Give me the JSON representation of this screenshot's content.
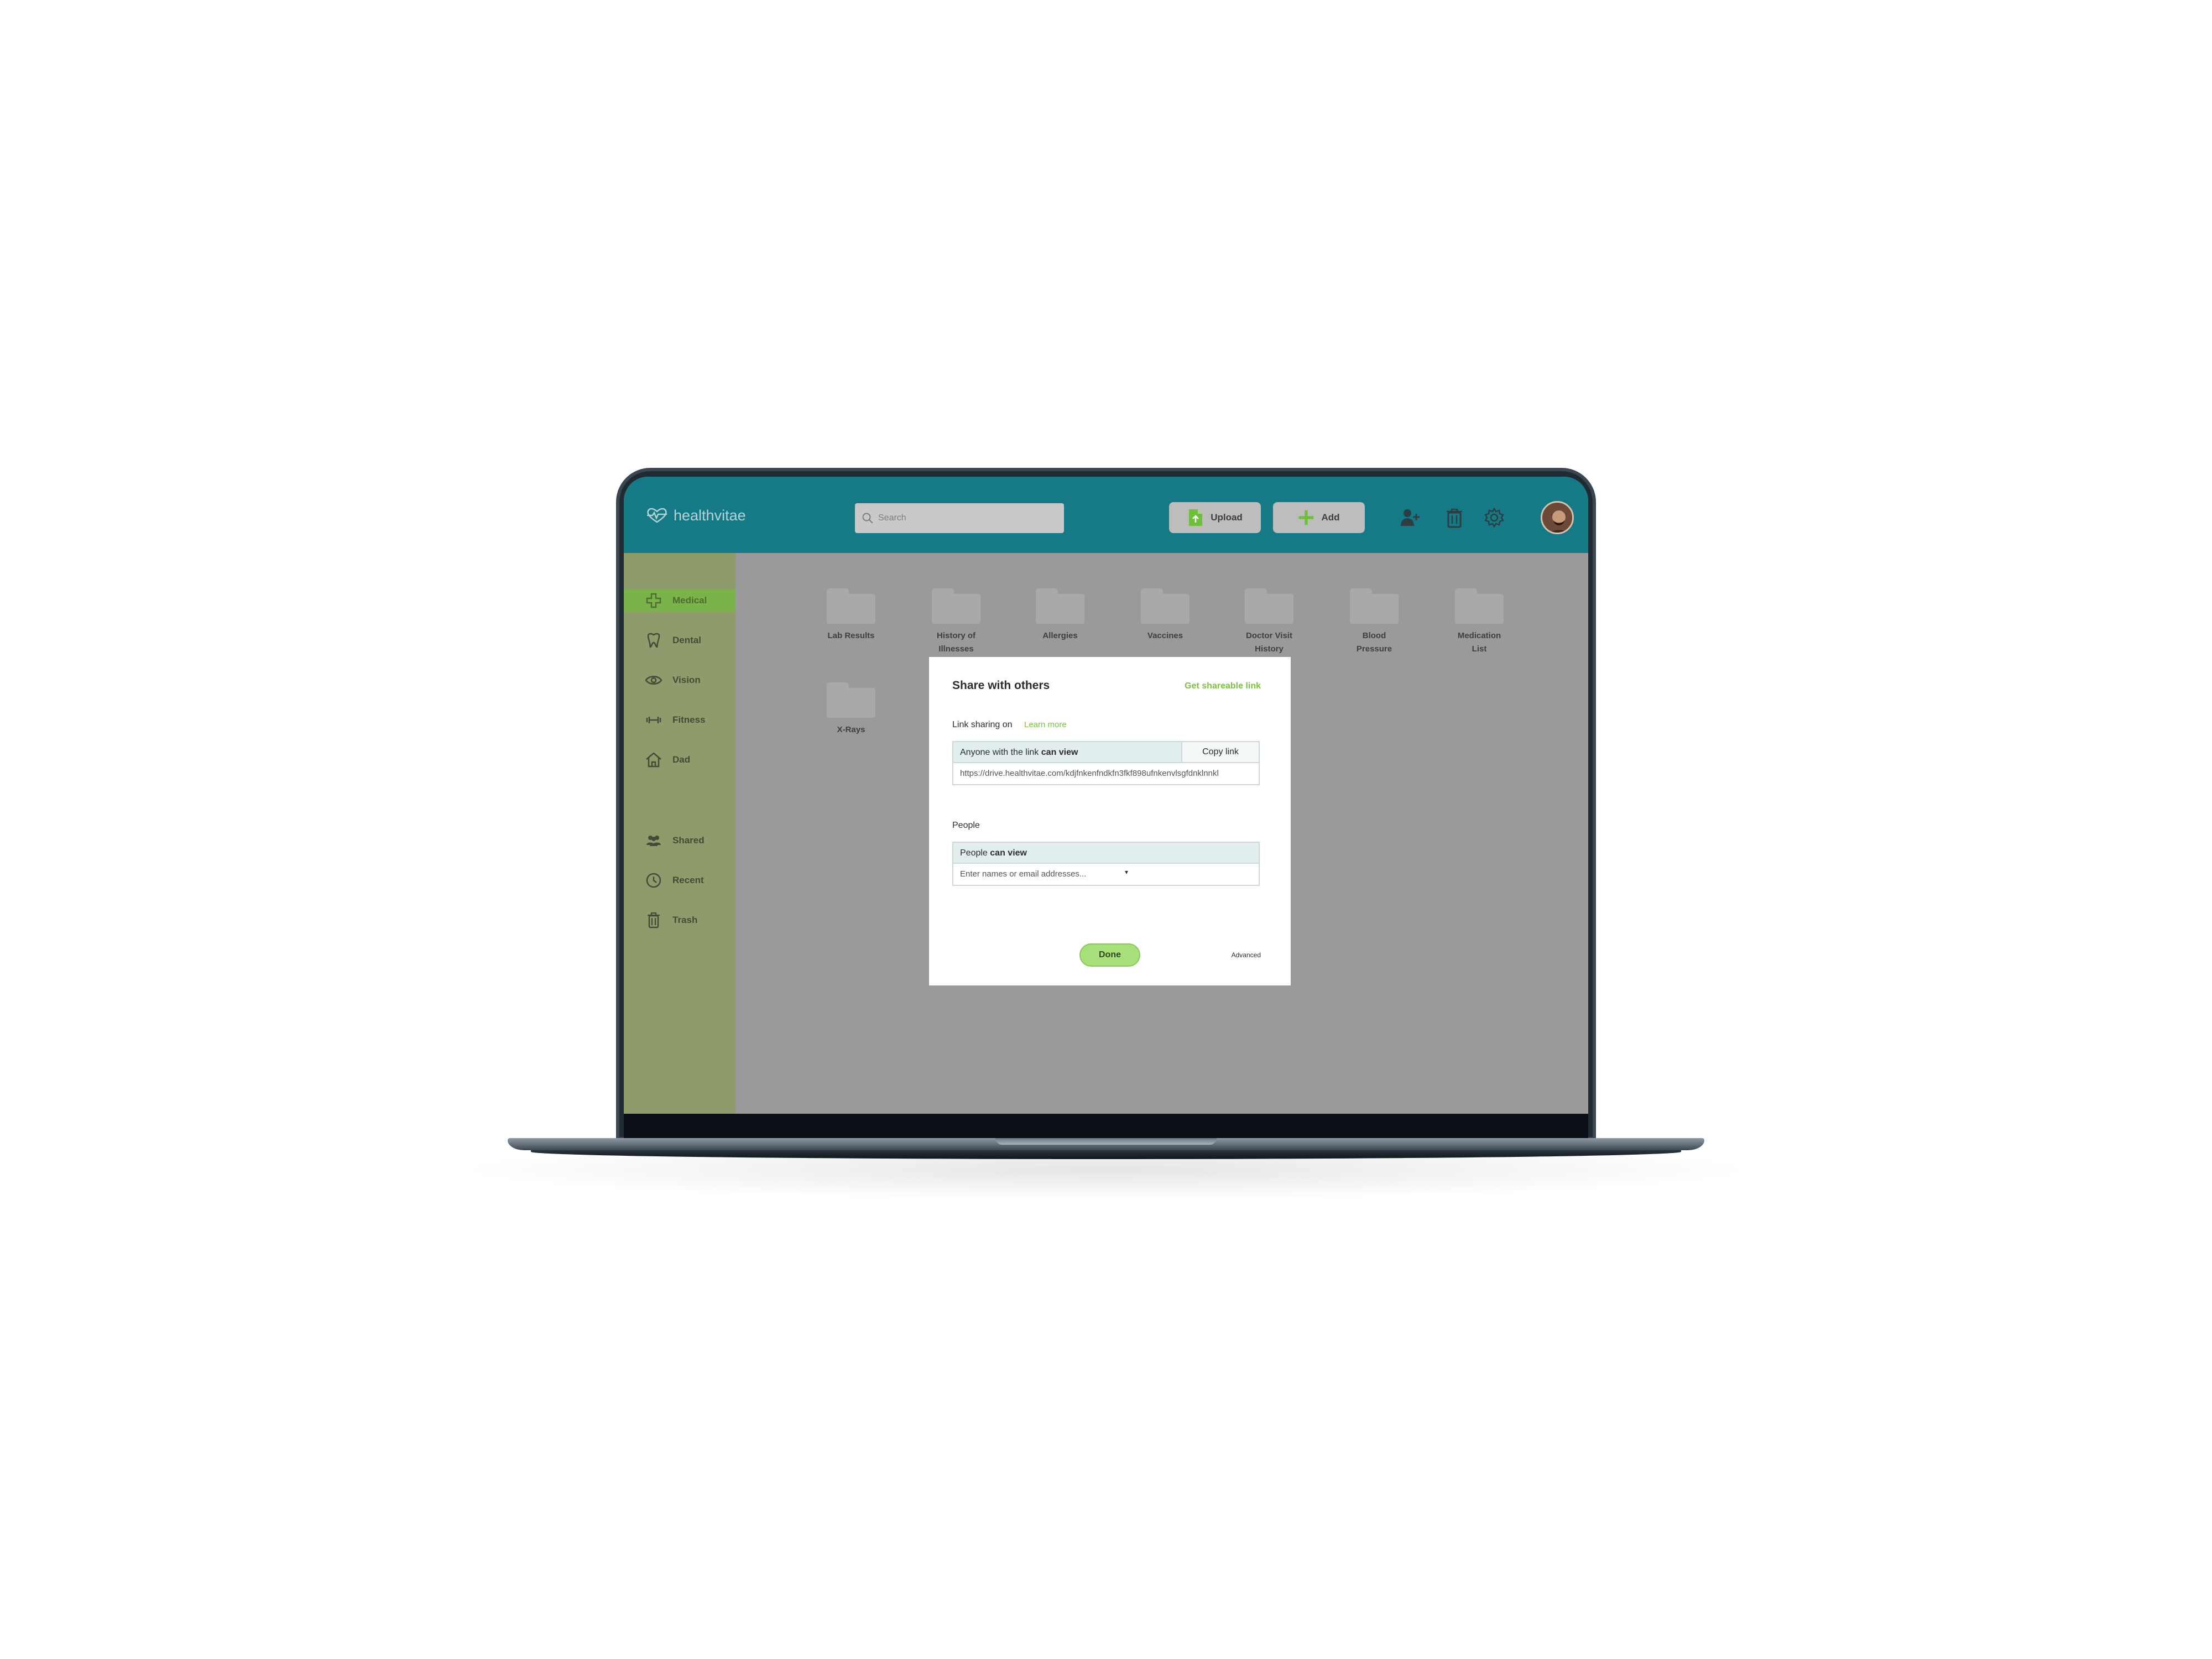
{
  "app": {
    "brand": "healthvitae",
    "search_placeholder": "Search",
    "upload_label": "Upload",
    "add_label": "Add"
  },
  "sidebar": {
    "items": [
      {
        "label": "Medical",
        "icon": "medical-cross-icon",
        "active": true
      },
      {
        "label": "Dental",
        "icon": "tooth-icon"
      },
      {
        "label": "Vision",
        "icon": "eye-icon"
      },
      {
        "label": "Fitness",
        "icon": "dumbbell-icon"
      },
      {
        "label": "Dad",
        "icon": "house-icon"
      },
      {
        "label": "Shared",
        "icon": "people-icon"
      },
      {
        "label": "Recent",
        "icon": "clock-icon"
      },
      {
        "label": "Trash",
        "icon": "trash-icon"
      }
    ]
  },
  "folders": [
    {
      "line1": "Lab Results",
      "line2": ""
    },
    {
      "line1": "History of",
      "line2": "Illnesses"
    },
    {
      "line1": "Allergies",
      "line2": ""
    },
    {
      "line1": "Vaccines",
      "line2": ""
    },
    {
      "line1": "Doctor Visit",
      "line2": "History"
    },
    {
      "line1": "Blood",
      "line2": "Pressure"
    },
    {
      "line1": "Medication",
      "line2": "List"
    },
    {
      "line1": "X-Rays",
      "line2": ""
    }
  ],
  "dialog": {
    "title": "Share with others",
    "get_link": "Get shareable link",
    "link_sharing": "Link sharing on",
    "learn_more": "Learn more",
    "anyone_prefix": "Anyone with the link",
    "anyone_perm": "can view",
    "copy_link": "Copy link",
    "url": "https://drive.healthvitae.com/kdjfnkenfndkfn3fkf898ufnkenvlsgfdnklnnkl",
    "people_label": "People",
    "people_prefix": "People",
    "people_perm": "can view",
    "people_placeholder": "Enter names or email addresses...",
    "done": "Done",
    "advanced": "Advanced"
  },
  "colors": {
    "header": "#157a86",
    "accent_green": "#7cc142",
    "sidebar": "#8e9c6c",
    "overlay_gray": "#9a9a9a"
  }
}
